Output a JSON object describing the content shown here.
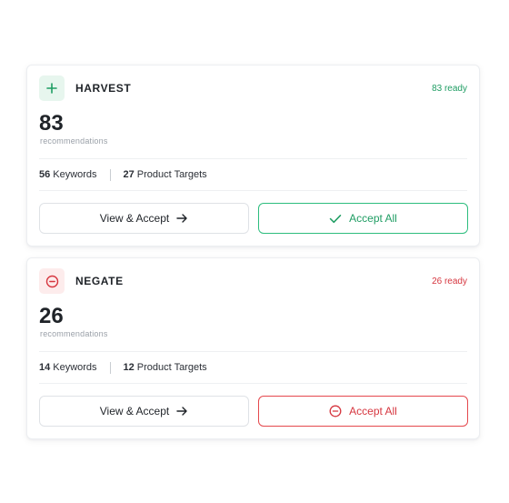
{
  "harvest": {
    "title": "HARVEST",
    "ready": "83 ready",
    "count": "83",
    "count_label": "recommendations",
    "keywords_count": "56",
    "keywords_label": "Keywords",
    "targets_count": "27",
    "targets_label": "Product Targets",
    "view_label": "View & Accept",
    "accept_label": "Accept All",
    "accent": "#1f9d63",
    "icon": "plus-icon"
  },
  "negate": {
    "title": "NEGATE",
    "ready": "26 ready",
    "count": "26",
    "count_label": "recommendations",
    "keywords_count": "14",
    "keywords_label": "Keywords",
    "targets_count": "12",
    "targets_label": "Product Targets",
    "view_label": "View & Accept",
    "accept_label": "Accept All",
    "accent": "#d6363f",
    "icon": "minus-circle-icon"
  }
}
